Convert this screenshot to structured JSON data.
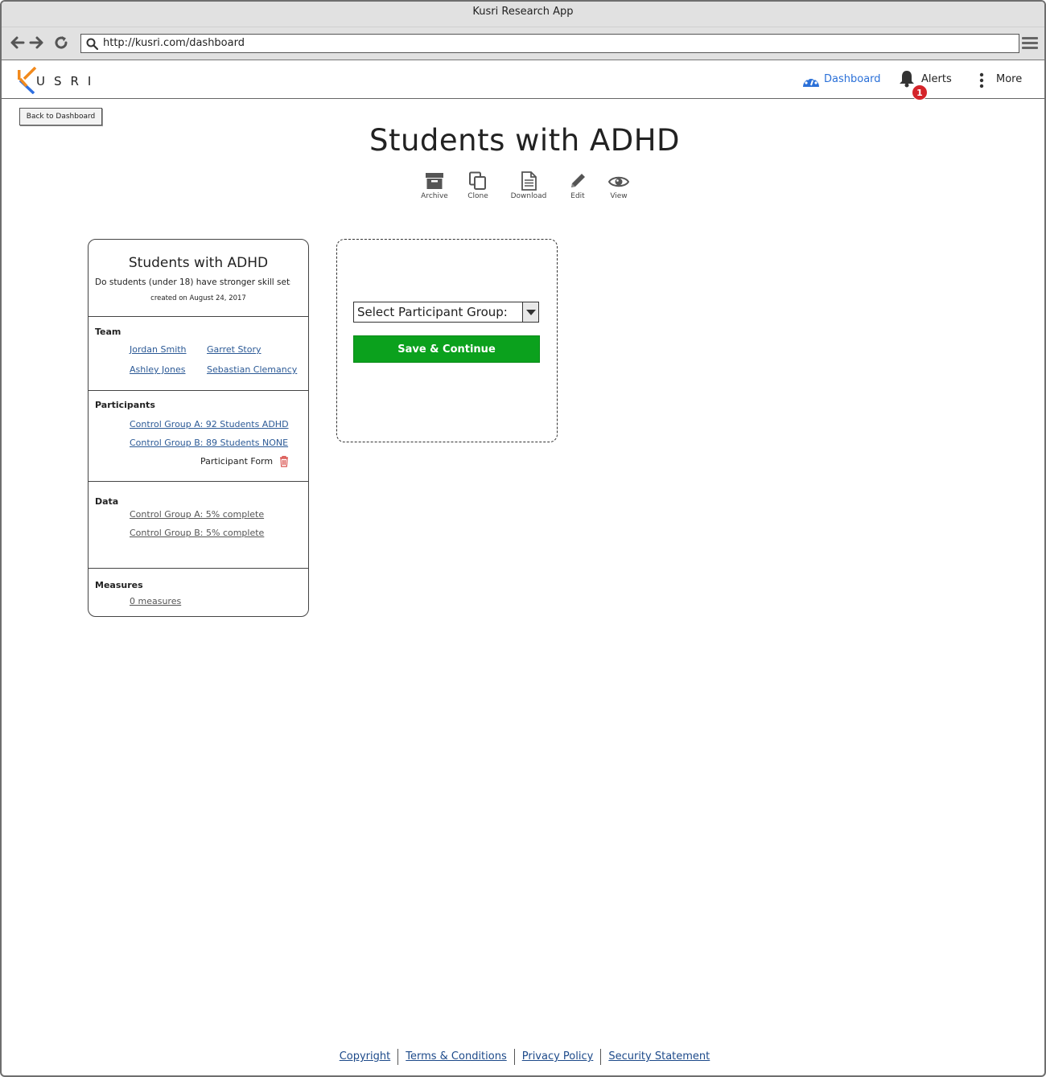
{
  "browser": {
    "window_title": "Kusri Research App",
    "url": "http://kusri.com/dashboard"
  },
  "header": {
    "logo_text": "USRI",
    "nav": {
      "dashboard": "Dashboard",
      "alerts": "Alerts",
      "alerts_count": "1",
      "more": "More"
    }
  },
  "back_button": "Back to Dashboard",
  "page_title": "Students with ADHD",
  "actions": {
    "archive": "Archive",
    "clone": "Clone",
    "download": "Download",
    "edit": "Edit",
    "view": "View"
  },
  "study_card": {
    "title": "Students with ADHD",
    "description": "Do students (under 18) have stronger skill sets",
    "created": "created on August 24, 2017",
    "team": {
      "title": "Team",
      "members": [
        "Jordan Smith",
        "Garret Story",
        "Ashley Jones",
        "Sebastian Clemancy"
      ]
    },
    "participants": {
      "title": "Participants",
      "groups": [
        "Control Group A: 92 Students ADHD",
        "Control Group B: 89 Students NONE"
      ],
      "form_label": "Participant Form"
    },
    "data": {
      "title": "Data",
      "items": [
        "Control Group A: 5% complete",
        "Control Group B: 5% complete"
      ]
    },
    "measures": {
      "title": "Measures",
      "link": "0 measures "
    }
  },
  "form_panel": {
    "select_value": "Select Participant Group:",
    "save_button": "Save & Continue"
  },
  "footer": {
    "links": [
      "Copyright",
      "Terms & Conditions",
      "Privacy Policy",
      "Security Statement"
    ]
  },
  "colors": {
    "accent_blue": "#2a70d8",
    "save_green": "#0ba11d",
    "alert_red": "#d4242a",
    "logo_orange": "#f28a1c",
    "logo_blue": "#2f6fe0"
  }
}
